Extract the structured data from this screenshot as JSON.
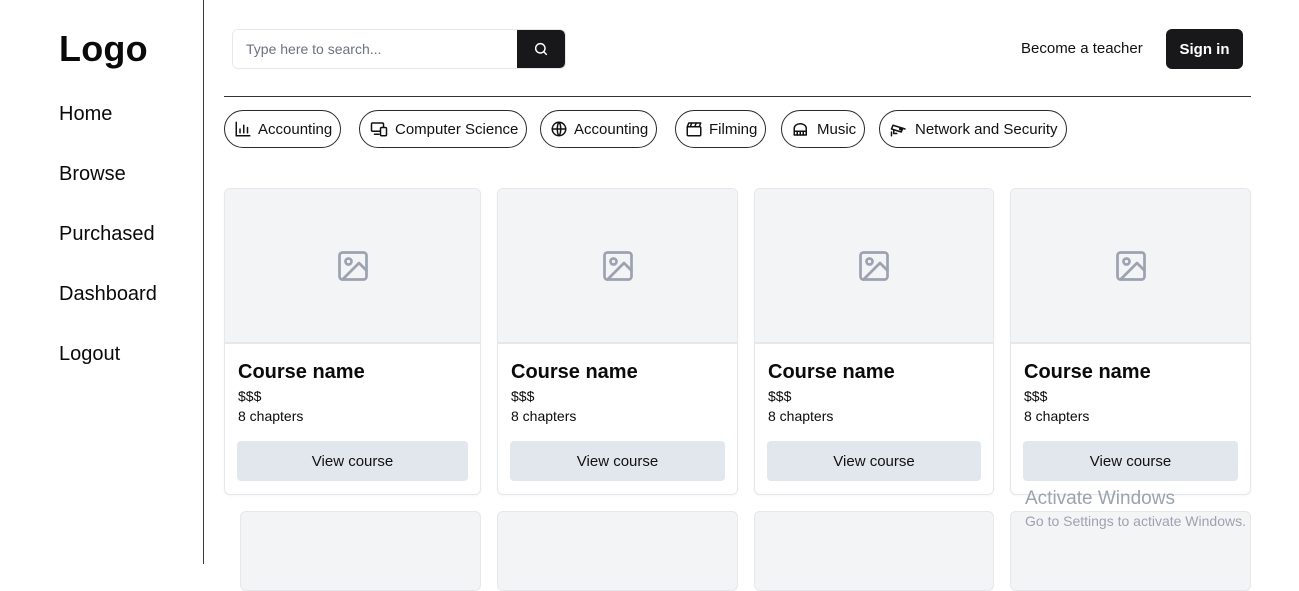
{
  "sidebar": {
    "logo": "Logo",
    "items": [
      {
        "label": "Home"
      },
      {
        "label": "Browse"
      },
      {
        "label": "Purchased"
      },
      {
        "label": "Dashboard"
      },
      {
        "label": "Logout"
      }
    ]
  },
  "header": {
    "search_placeholder": "Type here to search...",
    "search_icon": "search-icon",
    "become_teacher": "Become a teacher",
    "sign_in": "Sign in"
  },
  "categories": [
    {
      "label": "Accounting",
      "icon": "bar-chart-icon"
    },
    {
      "label": "Computer Science",
      "icon": "devices-icon"
    },
    {
      "label": "Accounting",
      "icon": "globe-icon"
    },
    {
      "label": "Filming",
      "icon": "clapperboard-icon"
    },
    {
      "label": "Music",
      "icon": "piano-icon"
    },
    {
      "label": "Network and Security",
      "icon": "cctv-icon"
    }
  ],
  "courses": [
    {
      "name": "Course name",
      "price": "$$$",
      "chapters": "8 chapters",
      "button": "View course",
      "image_icon": "image-placeholder-icon"
    },
    {
      "name": "Course name",
      "price": "$$$",
      "chapters": "8 chapters",
      "button": "View course",
      "image_icon": "image-placeholder-icon"
    },
    {
      "name": "Course name",
      "price": "$$$",
      "chapters": "8 chapters",
      "button": "View course",
      "image_icon": "image-placeholder-icon"
    },
    {
      "name": "Course name",
      "price": "$$$",
      "chapters": "8 chapters",
      "button": "View course",
      "image_icon": "image-placeholder-icon"
    }
  ],
  "watermark": {
    "line1": "Activate Windows",
    "line2": "Go to Settings to activate Windows."
  }
}
